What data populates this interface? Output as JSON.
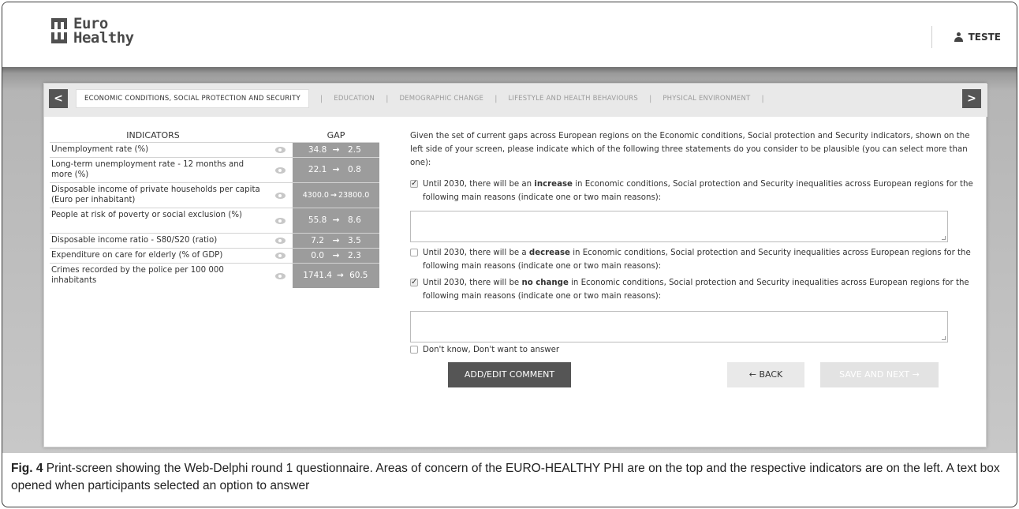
{
  "header": {
    "logo_line1": "Euro",
    "logo_line2": "Healthy",
    "user_name": "TESTE"
  },
  "tabs": [
    {
      "label": "ECONOMIC CONDITIONS, SOCIAL PROTECTION AND SECURITY",
      "active": true
    },
    {
      "label": "EDUCATION",
      "active": false
    },
    {
      "label": "DEMOGRAPHIC CHANGE",
      "active": false
    },
    {
      "label": "LIFESTYLE AND HEALTH BEHAVIOURS",
      "active": false
    },
    {
      "label": "PHYSICAL ENVIRONMENT",
      "active": false
    }
  ],
  "tab_separator": "|",
  "nav": {
    "prev_icon": "chevron-left-icon",
    "next_icon": "chevron-right-icon",
    "prev": "<",
    "next": ">"
  },
  "indicators": {
    "header_indicators": "INDICATORS",
    "header_gap": "GAP",
    "gap_arrow": "→",
    "rows": [
      {
        "name": "Unemployment rate (%)",
        "from": "34.8",
        "to": "2.5"
      },
      {
        "name": "Long-term unemployment rate - 12 months and more (%)",
        "from": "22.1",
        "to": "0.8"
      },
      {
        "name": "Disposable income of private households per capita (Euro per inhabitant)",
        "from": "4300.0",
        "to": "23800.0"
      },
      {
        "name": "People at risk of poverty or social exclusion (%)",
        "from": "55.8",
        "to": "8.6"
      },
      {
        "name": "Disposable income ratio - S80/S20 (ratio)",
        "from": "7.2",
        "to": "3.5"
      },
      {
        "name": "Expenditure on care for elderly (% of GDP)",
        "from": "0.0",
        "to": "2.3"
      },
      {
        "name": "Crimes recorded by the police per 100 000 inhabitants",
        "from": "1741.4",
        "to": "60.5"
      }
    ]
  },
  "question": {
    "intro": "Given the set of current gaps across European regions on the Economic conditions, Social protection and Security indicators, shown on the left side of your screen, please indicate which of the following three statements do you consider to be plausible (you can select more than one):",
    "increase": {
      "checked": true,
      "pre": "Until 2030, there will be an ",
      "bold": "increase",
      "post": " in Economic conditions, Social protection and Security inequalities across European regions for the following main reasons (indicate one or two main reasons):"
    },
    "decrease": {
      "checked": false,
      "pre": "Until 2030, there will be a ",
      "bold": "decrease",
      "post": " in Economic conditions, Social protection and Security inequalities across European regions for the following main reasons (indicate one or two main reasons):"
    },
    "nochange": {
      "checked": true,
      "pre": "Until 2030, there will be ",
      "bold": "no change",
      "post": " in Economic conditions, Social protection and Security inequalities across European regions for the following main reasons (indicate one or two main reasons):"
    },
    "dontknow": {
      "checked": false,
      "label": "Don't know, Don't want to answer"
    }
  },
  "buttons": {
    "comment": "ADD/EDIT COMMENT",
    "back": "← BACK",
    "next": "SAVE AND NEXT →"
  },
  "caption": {
    "label": "Fig. 4",
    "text": " Print-screen showing the Web-Delphi round 1 questionnaire. Areas of concern of the EURO-HEALTHY PHI are on the top and the respective indicators are on the left. A text box opened when participants selected an option to answer"
  }
}
